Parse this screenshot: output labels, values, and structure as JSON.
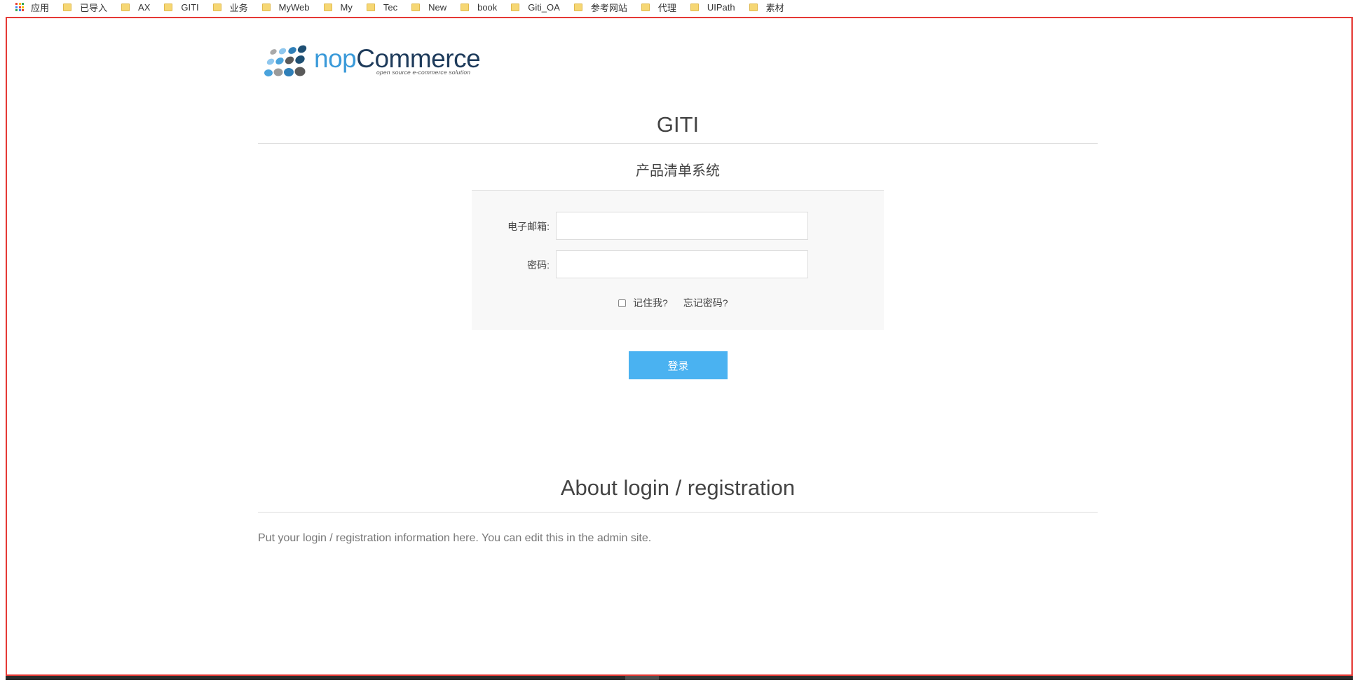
{
  "bookmarks": {
    "apps_label": "应用",
    "items": [
      "已导入",
      "AX",
      "GITI",
      "业务",
      "MyWeb",
      "My",
      "Tec",
      "New",
      "book",
      "Giti_OA",
      "参考网站",
      "代理",
      "UIPath",
      "素材"
    ]
  },
  "logo": {
    "brand_prefix": "nop",
    "brand_suffix": "Commerce",
    "tagline": "open source e-commerce solution"
  },
  "page": {
    "site_title": "GITI",
    "subtitle": "产品清单系统"
  },
  "login_form": {
    "email_label": "电子邮箱:",
    "email_value": "",
    "password_label": "密码:",
    "password_value": "",
    "remember_label": "记住我?",
    "remember_checked": false,
    "forgot_link": "忘记密码?",
    "submit_label": "登录"
  },
  "about": {
    "title": "About login / registration",
    "body": "Put your login / registration information here. You can edit this in the admin site."
  },
  "colors": {
    "accent": "#4ab2f1",
    "frame_border": "#e53935",
    "form_bg": "#f8f8f8"
  }
}
